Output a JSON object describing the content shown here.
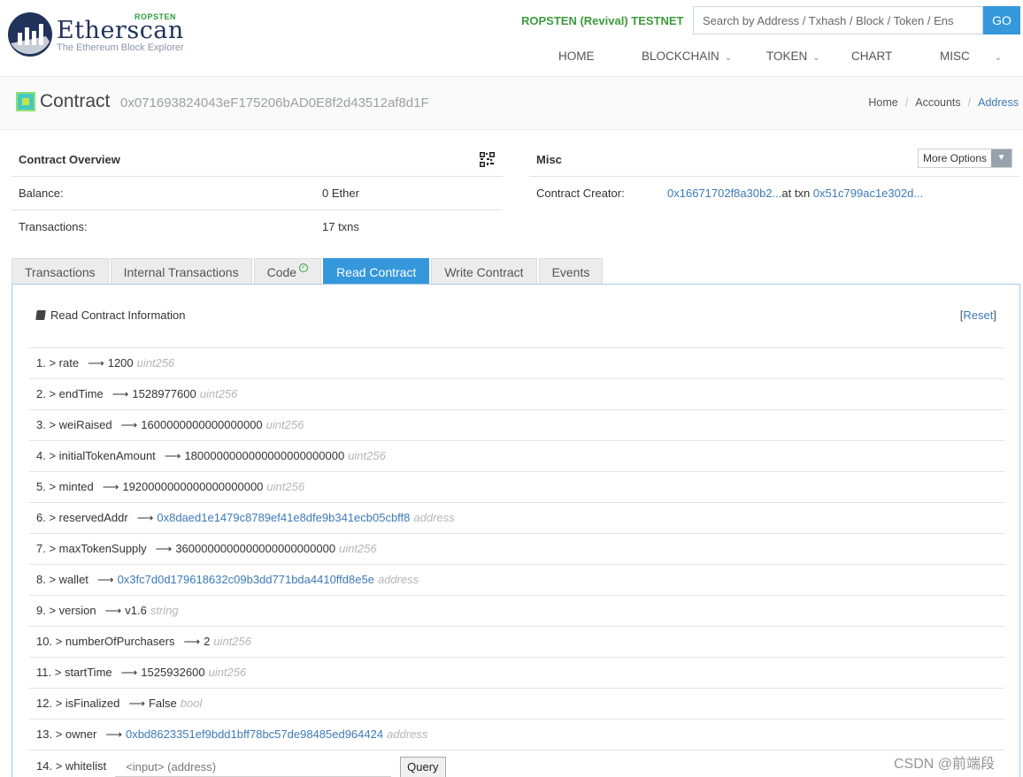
{
  "header": {
    "brand": "Etherscan",
    "tagline": "The Ethereum Block Explorer",
    "network_badge": "ROPSTEN",
    "network": "ROPSTEN (Revival) TESTNET",
    "search_placeholder": "Search by Address / Txhash / Block / Token / Ens",
    "go_label": "GO",
    "nav": [
      {
        "label": "HOME"
      },
      {
        "label": "BLOCKCHAIN"
      },
      {
        "label": "TOKEN"
      },
      {
        "label": "CHART"
      },
      {
        "label": "MISC"
      }
    ]
  },
  "subheader": {
    "title": "Contract",
    "address": "0x071693824043eF175206bAD0E8f2d43512af8d1F",
    "breadcrumb": [
      "Home",
      "Accounts",
      "Address"
    ]
  },
  "overview": {
    "title": "Contract Overview",
    "balance_label": "Balance:",
    "balance_value": "0 Ether",
    "txns_label": "Transactions:",
    "txns_value": "17 txns"
  },
  "misc": {
    "title": "Misc",
    "more_options": "More Options",
    "creator_label": "Contract Creator:",
    "creator_addr": "0x16671702f8a30b2...",
    "at_txn": "at txn",
    "creator_txn": "0x51c799ac1e302d..."
  },
  "tabs": [
    {
      "label": "Transactions"
    },
    {
      "label": "Internal Transactions"
    },
    {
      "label": "Code"
    },
    {
      "label": "Read Contract"
    },
    {
      "label": "Write Contract"
    },
    {
      "label": "Events"
    }
  ],
  "read_contract": {
    "title": "Read Contract Information",
    "reset_open": "[",
    "reset_label": "Reset",
    "reset_close": "]",
    "rows": [
      {
        "num": "1.",
        "name": "rate",
        "value": "1200",
        "type": "uint256"
      },
      {
        "num": "2.",
        "name": "endTime",
        "value": "1528977600",
        "type": "uint256"
      },
      {
        "num": "3.",
        "name": "weiRaised",
        "value": "1600000000000000000",
        "type": "uint256"
      },
      {
        "num": "4.",
        "name": "initialTokenAmount",
        "value": "1800000000000000000000000",
        "type": "uint256"
      },
      {
        "num": "5.",
        "name": "minted",
        "value": "1920000000000000000000",
        "type": "uint256"
      },
      {
        "num": "6.",
        "name": "reservedAddr",
        "value": "0x8daed1e1479c8789ef41e8dfe9b341ecb05cbff8",
        "type": "address"
      },
      {
        "num": "7.",
        "name": "maxTokenSupply",
        "value": "3600000000000000000000000",
        "type": "uint256"
      },
      {
        "num": "8.",
        "name": "wallet",
        "value": "0x3fc7d0d179618632c09b3dd771bda4410ffd8e5e",
        "type": "address"
      },
      {
        "num": "9.",
        "name": "version",
        "value": "v1.6",
        "type": "string"
      },
      {
        "num": "10.",
        "name": "numberOfPurchasers",
        "value": "2",
        "type": "uint256"
      },
      {
        "num": "11.",
        "name": "startTime",
        "value": "1525932600",
        "type": "uint256"
      },
      {
        "num": "12.",
        "name": "isFinalized",
        "value": "False",
        "type": "bool"
      },
      {
        "num": "13.",
        "name": "owner",
        "value": "0xbd8623351ef9bdd1bff78bc57de98485ed964424",
        "type": "address"
      }
    ],
    "whitelist": {
      "num": "14.",
      "name": "whitelist",
      "placeholder": "<input> (address)",
      "query_label": "Query"
    }
  },
  "watermark": "CSDN @前端段"
}
